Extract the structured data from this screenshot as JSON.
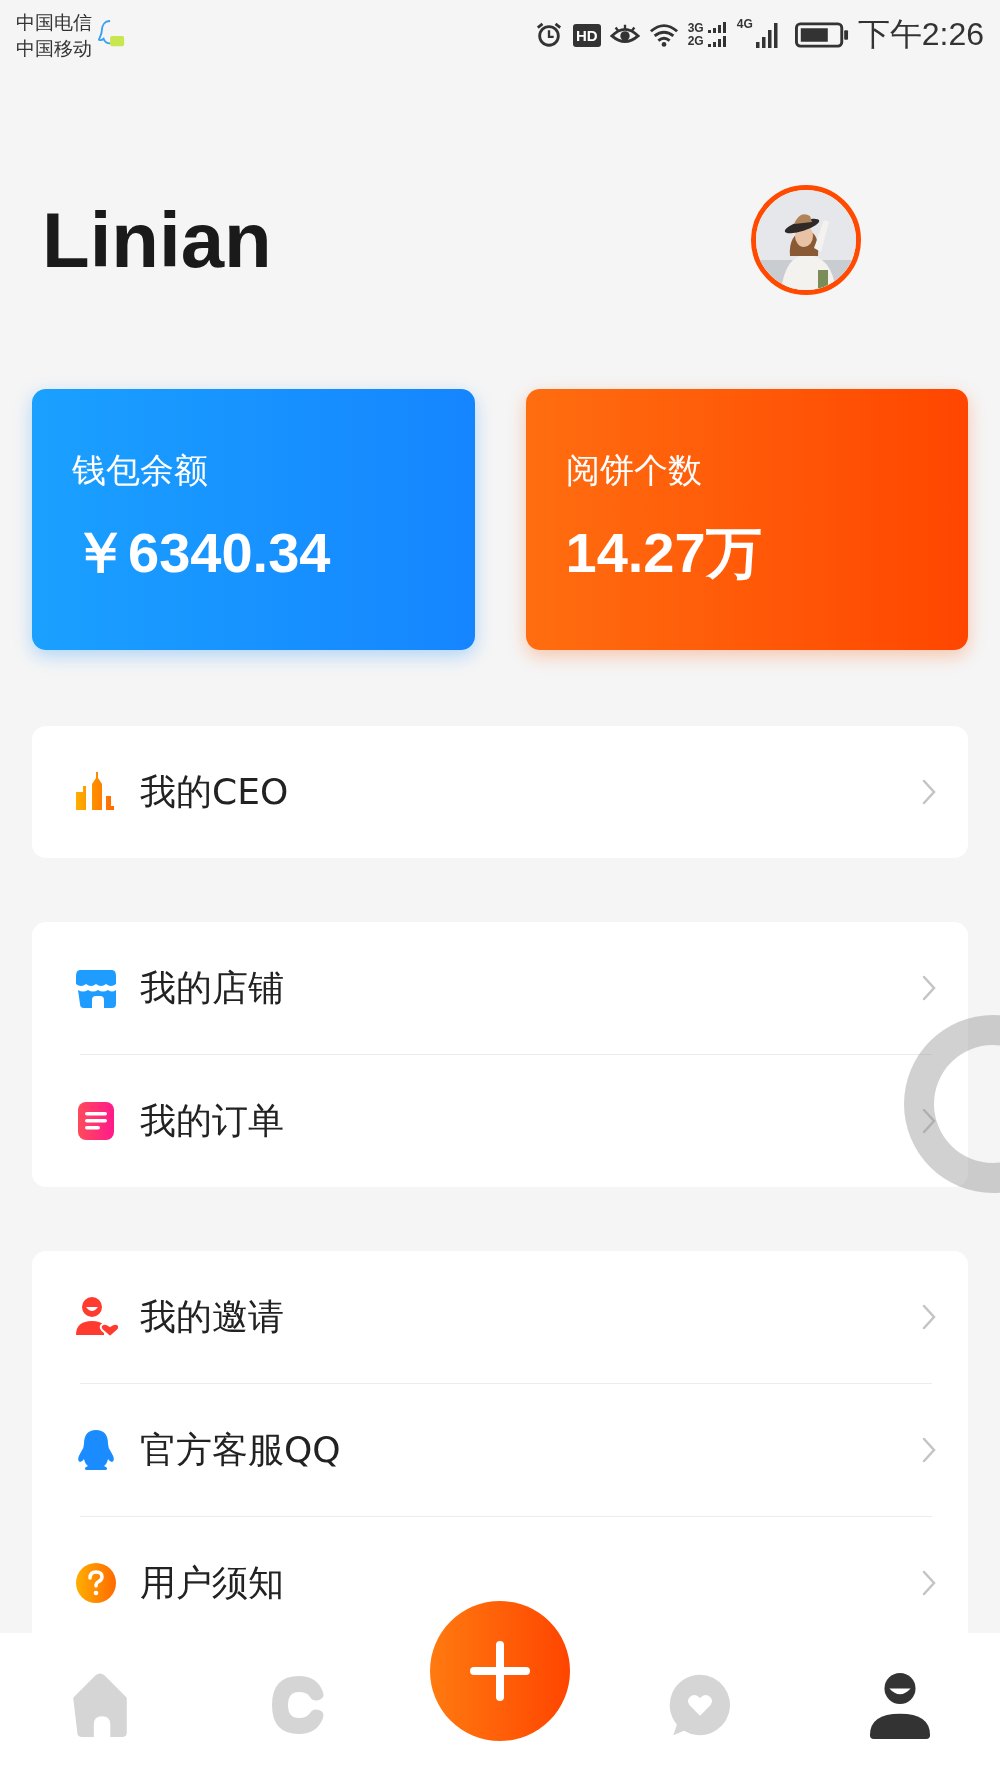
{
  "status_bar": {
    "carriers": [
      "中国电信",
      "中国移动"
    ],
    "hd": "HD",
    "network_top": "3G",
    "network_bottom": "2G",
    "network_4g": "4G",
    "time": "下午2:26"
  },
  "profile": {
    "name": "Linian"
  },
  "stats": [
    {
      "kind": "wallet",
      "label": "钱包余额",
      "value": "￥6340.34"
    },
    {
      "kind": "cookies",
      "label": "阅饼个数",
      "value": "14.27万"
    }
  ],
  "menu_groups": [
    [
      {
        "kind": "ceo",
        "label": "我的CEO"
      }
    ],
    [
      {
        "kind": "shop",
        "label": "我的店铺"
      },
      {
        "kind": "order",
        "label": "我的订单"
      }
    ],
    [
      {
        "kind": "invite",
        "label": "我的邀请"
      },
      {
        "kind": "qq",
        "label": "官方客服QQ"
      },
      {
        "kind": "help",
        "label": "用户须知"
      }
    ]
  ],
  "bottom_nav": [
    {
      "kind": "home",
      "selected": false
    },
    {
      "kind": "c",
      "selected": false
    },
    {
      "kind": "plus",
      "selected": false
    },
    {
      "kind": "chat",
      "selected": false
    },
    {
      "kind": "person",
      "selected": true
    }
  ]
}
